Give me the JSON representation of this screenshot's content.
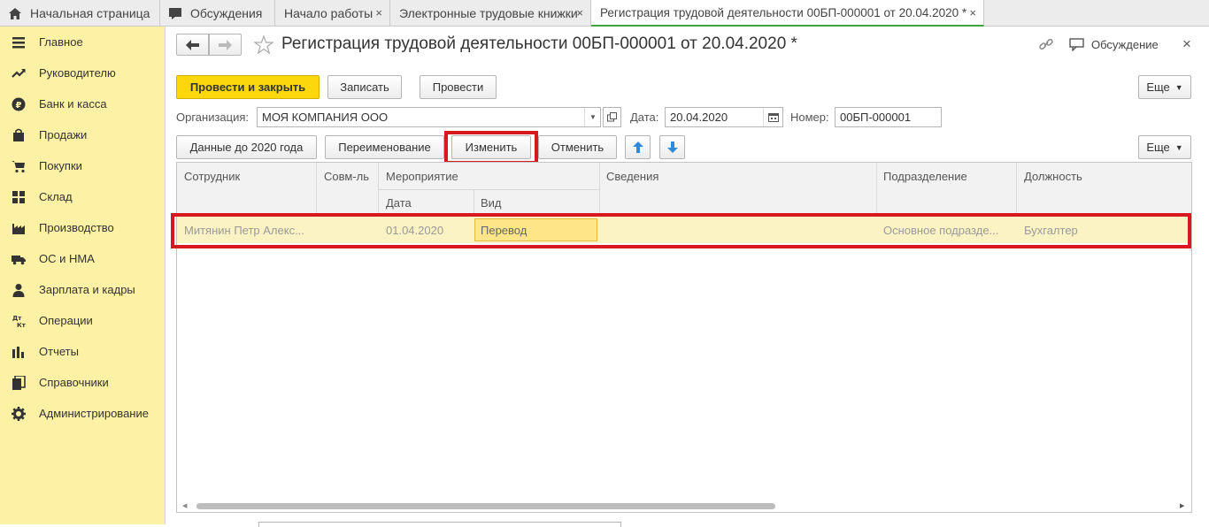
{
  "tabs": [
    {
      "label": "Начальная страница",
      "icon": "home-icon"
    },
    {
      "label": "Обсуждения",
      "icon": "chat-icon"
    },
    {
      "label": "Начало работы",
      "close": "×"
    },
    {
      "label": "Электронные трудовые книжки",
      "close": "×"
    },
    {
      "label": "Регистрация трудовой деятельности 00БП-000001 от 20.04.2020 *",
      "close": "×"
    }
  ],
  "sidebar": {
    "items": [
      {
        "label": "Главное",
        "icon": "menu-icon"
      },
      {
        "label": "Руководителю",
        "icon": "trend-icon"
      },
      {
        "label": "Банк и касса",
        "icon": "ruble-icon"
      },
      {
        "label": "Продажи",
        "icon": "bag-icon"
      },
      {
        "label": "Покупки",
        "icon": "cart-icon"
      },
      {
        "label": "Склад",
        "icon": "warehouse-icon"
      },
      {
        "label": "Производство",
        "icon": "factory-icon"
      },
      {
        "label": "ОС и НМА",
        "icon": "truck-icon"
      },
      {
        "label": "Зарплата и кадры",
        "icon": "person-icon"
      },
      {
        "label": "Операции",
        "icon": "dt-kt-icon"
      },
      {
        "label": "Отчеты",
        "icon": "bar-chart-icon"
      },
      {
        "label": "Справочники",
        "icon": "book-icon"
      },
      {
        "label": "Администрирование",
        "icon": "gear-icon"
      }
    ]
  },
  "header": {
    "title": "Регистрация трудовой деятельности 00БП-000001 от 20.04.2020 *",
    "discussion": "Обсуждение",
    "close": "×"
  },
  "toolbar": {
    "post_close": "Провести и закрыть",
    "save": "Записать",
    "post": "Провести",
    "more": "Еще"
  },
  "form": {
    "org_label": "Организация:",
    "org_value": "МОЯ КОМПАНИЯ ООО",
    "date_label": "Дата:",
    "date_value": "20.04.2020",
    "number_label": "Номер:",
    "number_value": "00БП-000001"
  },
  "table_toolbar": {
    "pre2020": "Данные до 2020 года",
    "rename": "Переименование",
    "change": "Изменить",
    "cancel": "Отменить",
    "more": "Еще"
  },
  "table": {
    "headers": {
      "employee": "Сотрудник",
      "part_time": "Совм-ль",
      "event": "Мероприятие",
      "event_date": "Дата",
      "event_type": "Вид",
      "info": "Сведения",
      "department": "Подразделение",
      "position": "Должность"
    },
    "rows": [
      {
        "employee": "Митянин Петр Алекс...",
        "part_time": "",
        "event_date": "01.04.2020",
        "event_type": "Перевод",
        "info": "",
        "department": "Основное подразде...",
        "position": "Бухгалтер"
      }
    ]
  },
  "colors": {
    "sidebar_bg": "#fcf1a4",
    "primary_button": "#fbd70b",
    "highlight_red": "#d71820",
    "row_selected": "#fcf3c5",
    "active_tab_underline": "#41a341"
  }
}
